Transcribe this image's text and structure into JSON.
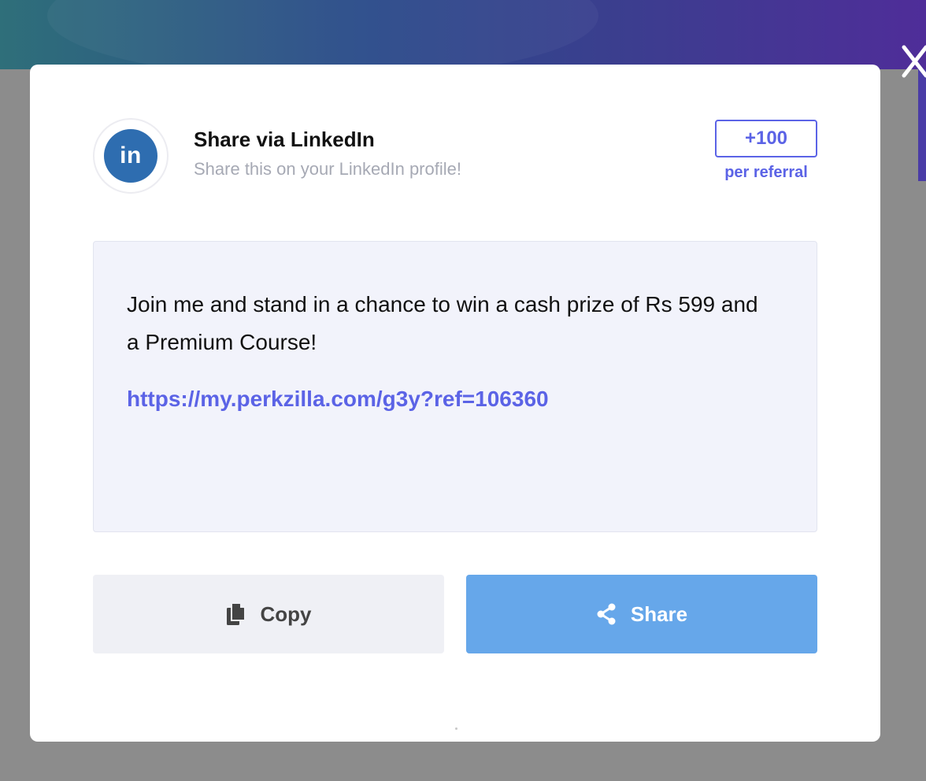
{
  "modal": {
    "title": "Share via LinkedIn",
    "subtitle": "Share this on your LinkedIn profile!",
    "avatar_text": "in",
    "points": "+100",
    "points_caption": "per referral",
    "message": "Join me and stand in a chance to win a cash prize of Rs 599 and a Premium Course!",
    "link": "https://my.perkzilla.com/g3y?ref=106360",
    "copy_label": "Copy",
    "share_label": "Share"
  },
  "icons": {
    "close": "close-icon",
    "linkedin": "linkedin-icon",
    "copy": "copy-icon",
    "share": "share-icon"
  },
  "colors": {
    "accent": "#5b63e6",
    "linkedin": "#2e6db0",
    "share_button": "#66a7ea",
    "copy_button": "#eff0f5",
    "message_background": "#f2f3fb"
  }
}
